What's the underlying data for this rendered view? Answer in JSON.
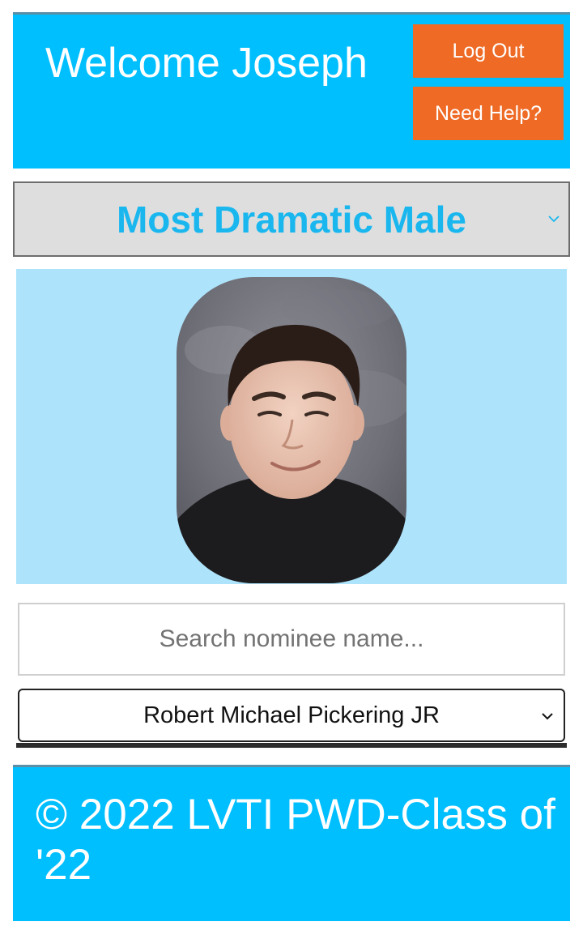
{
  "header": {
    "welcome": "Welcome Joseph",
    "logout_label": "Log Out",
    "help_label": "Need Help?"
  },
  "category": {
    "selected": "Most Dramatic Male",
    "icon": "chevron-down-icon"
  },
  "nominee_photo": {
    "description": "portrait"
  },
  "search": {
    "placeholder": "Search nominee name...",
    "value": ""
  },
  "nominee": {
    "selected": "Robert Michael Pickering JR",
    "icon": "chevron-down-icon"
  },
  "footer": {
    "text": "© 2022 LVTI PWD-Class of '22"
  },
  "colors": {
    "brand": "#00bfff",
    "button": "#ee6a25",
    "panel": "#ade4fc",
    "accent_text": "#1ab7ef"
  }
}
